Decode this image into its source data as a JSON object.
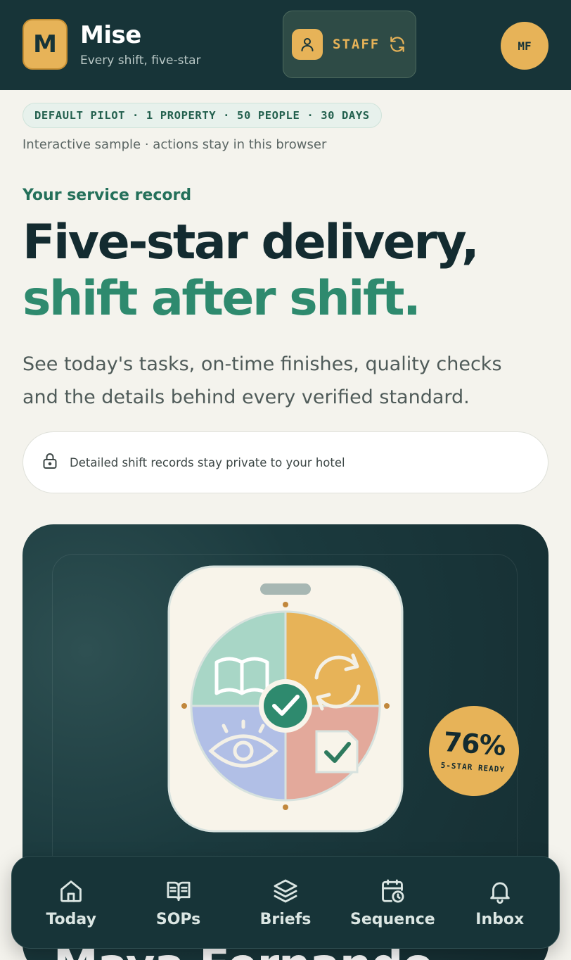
{
  "header": {
    "logo_letter": "M",
    "brand_name": "Mise",
    "brand_tagline": "Every shift, five-star",
    "role_label": "STAFF",
    "avatar_initials": "MF",
    "colors": {
      "background": "#173438",
      "accent": "#e7b358"
    }
  },
  "pilot": {
    "chip": "DEFAULT PILOT · 1 PROPERTY · 50 PEOPLE · 30 DAYS",
    "note": "Interactive sample · actions stay in this browser"
  },
  "hero": {
    "eyebrow": "Your service record",
    "line1": "Five-star delivery,",
    "line2": "shift after shift.",
    "lede": "See today's tasks, on-time finishes, quality checks and the details behind every verified standard.",
    "privacy_note": "Detailed shift records stay private to your hotel"
  },
  "card": {
    "score_value": "76%",
    "score_label": "5-STAR READY",
    "name": "Maya Fernando",
    "colors": {
      "background": "#173438",
      "badge": "#e7b358",
      "green": "#2e8a6e"
    }
  },
  "icons": {
    "role": "person-icon",
    "swap": "swap-icon",
    "lock": "lock-icon",
    "illustration": [
      "book-icon",
      "refresh-icon",
      "eye-icon",
      "checklist-icon",
      "check-icon"
    ]
  },
  "nav": {
    "items": [
      {
        "label": "Today",
        "icon": "home-icon"
      },
      {
        "label": "SOPs",
        "icon": "book-icon"
      },
      {
        "label": "Briefs",
        "icon": "layers-icon"
      },
      {
        "label": "Sequence",
        "icon": "calendar-clock-icon"
      },
      {
        "label": "Inbox",
        "icon": "bell-icon"
      }
    ]
  }
}
